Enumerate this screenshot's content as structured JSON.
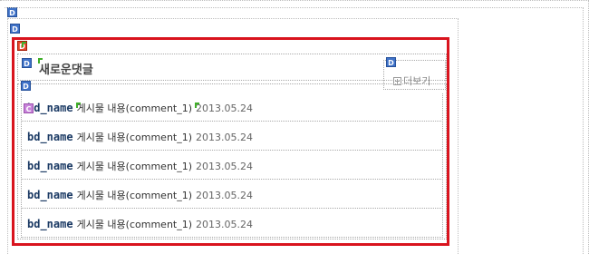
{
  "markers": {
    "label_d": "D",
    "label_c": "C"
  },
  "widget": {
    "title": "새로운댓글",
    "more_label": "더보기"
  },
  "comments": [
    {
      "name": "bd_name",
      "content": "게시물 내용(comment_1)",
      "date": "2013.05.24"
    },
    {
      "name": "bd_name",
      "content": "게시물 내용(comment_1)",
      "date": "2013.05.24"
    },
    {
      "name": "bd_name",
      "content": "게시물 내용(comment_1)",
      "date": "2013.05.24"
    },
    {
      "name": "bd_name",
      "content": "게시물 내용(comment_1)",
      "date": "2013.05.24"
    },
    {
      "name": "bd_name",
      "content": "게시물 내용(comment_1)",
      "date": "2013.05.24"
    }
  ],
  "colors": {
    "selection_border": "#d9141e",
    "marker_blue": "#3f72c8",
    "marker_red": "#e8472b",
    "marker_purple": "#c783da",
    "name_text": "#1b3a64"
  }
}
